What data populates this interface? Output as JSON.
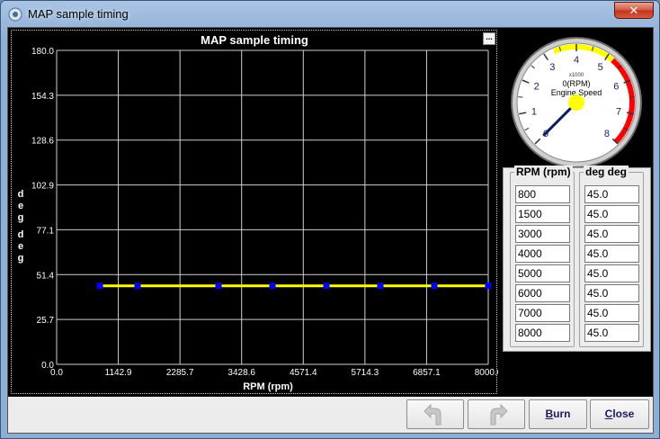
{
  "window": {
    "title": "MAP sample timing",
    "close_glyph": "✕"
  },
  "chart_data": {
    "type": "line",
    "title": "MAP sample timing",
    "xlabel": "RPM (rpm)",
    "ylabel_lines": [
      "deg",
      "deg"
    ],
    "xlim": [
      0,
      8000
    ],
    "ylim": [
      0,
      180
    ],
    "x_ticks": [
      "0.0",
      "1142.9",
      "2285.7",
      "3428.6",
      "4571.4",
      "5714.3",
      "6857.1",
      "8000.0"
    ],
    "y_ticks": [
      "0.0",
      "25.7",
      "51.4",
      "77.1",
      "102.9",
      "128.6",
      "154.3",
      "180.0"
    ],
    "series": [
      {
        "x": [
          800,
          1500,
          3000,
          4000,
          5000,
          6000,
          7000,
          8000
        ],
        "y": [
          45,
          45,
          45,
          45,
          45,
          45,
          45,
          45
        ]
      }
    ],
    "colors": {
      "line": "#ffff00",
      "point": "#0000ff",
      "grid": "#d0d0d0"
    }
  },
  "chart_menu_label": "...",
  "gauge": {
    "value_text": "0(RPM)",
    "title": "Engine Speed",
    "multiplier": "x1000",
    "value": 0,
    "min": 0,
    "max": 8,
    "ticks": [
      "0",
      "1",
      "2",
      "3",
      "4",
      "5",
      "6",
      "7",
      "8"
    ],
    "warn_color": "#ffff00",
    "danger_color": "#ff0000"
  },
  "table": {
    "rpm_header": "RPM (rpm)",
    "deg_header": "deg deg",
    "rpm_values": [
      "800",
      "1500",
      "3000",
      "4000",
      "5000",
      "6000",
      "7000",
      "8000"
    ],
    "deg_values": [
      "45.0",
      "45.0",
      "45.0",
      "45.0",
      "45.0",
      "45.0",
      "45.0",
      "45.0"
    ]
  },
  "buttons": {
    "undo_icon": "undo-icon",
    "redo_icon": "redo-icon",
    "burn_label_u": "B",
    "burn_label_rest": "urn",
    "close_label_u": "C",
    "close_label_rest": "lose"
  }
}
